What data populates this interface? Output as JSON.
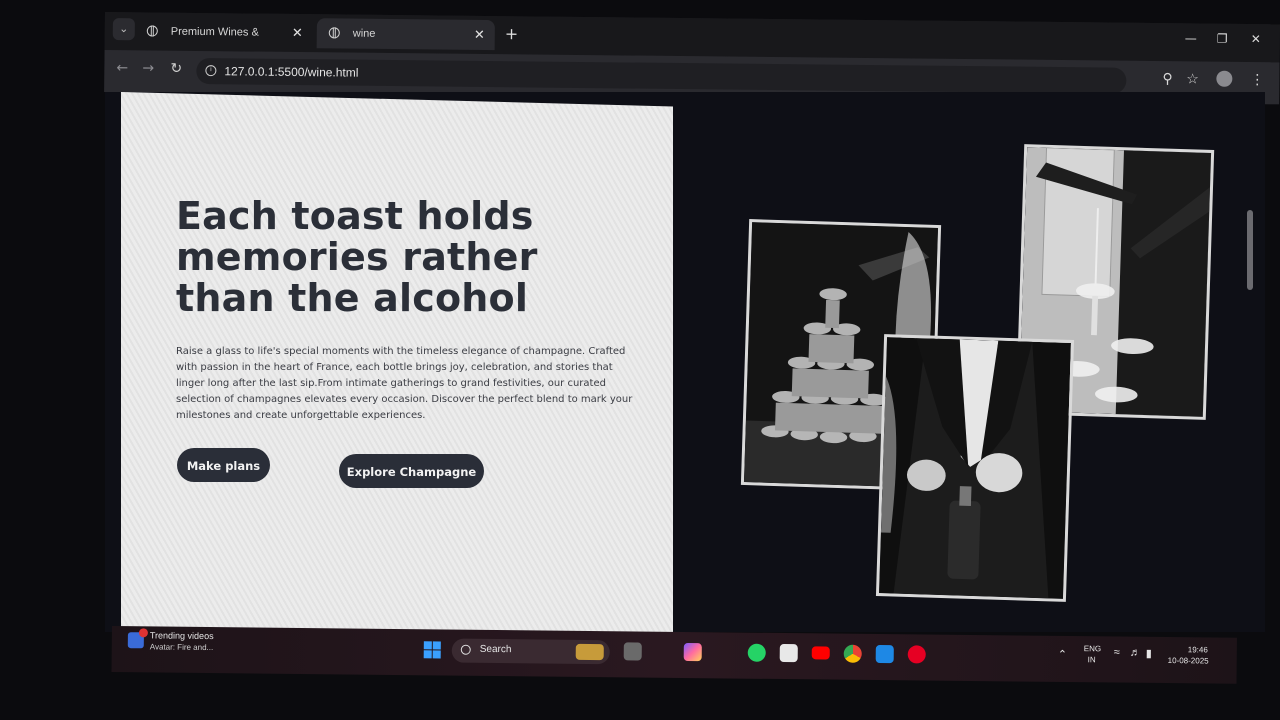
{
  "browser": {
    "tabs": [
      {
        "title": "Premium Wines & Beverages -",
        "active": false
      },
      {
        "title": "wine",
        "active": true
      }
    ],
    "url": "127.0.0.1:5500/wine.html"
  },
  "hero": {
    "headline": "Each toast holds memories rather than the alcohol",
    "paragraph": "Raise a glass to life's special moments with the timeless elegance of champagne. Crafted with passion in the heart of France, each bottle brings joy, celebration, and stories that linger long after the last sip.From intimate gatherings to grand festivities, our curated selection of champagnes elevates every occasion. Discover the perfect blend to mark your milestones and create unforgettable experiences.",
    "buttons": {
      "primary": "Make plans",
      "secondary": "Explore Champagne"
    }
  },
  "taskbar": {
    "news_title": "Trending videos",
    "news_subtitle": "Avatar: Fire and...",
    "search_label": "Search",
    "language": "ENG",
    "region": "IN",
    "time": "19:46",
    "date": "10-08-2025"
  },
  "colors": {
    "button_bg": "#2a2e38",
    "card_bg": "#e8e8e8",
    "page_bg": "#0e0f16"
  },
  "icons": [
    "tab-menu-icon",
    "globe-icon",
    "close-icon",
    "plus-icon",
    "minimize-icon",
    "restore-icon",
    "back-icon",
    "forward-icon",
    "reload-icon",
    "info-icon",
    "zoom-icon",
    "star-icon",
    "profile-icon",
    "more-icon",
    "windows-start-icon",
    "search-icon",
    "whatsapp-icon",
    "store-icon",
    "youtube-icon",
    "chrome-icon",
    "vscode-icon",
    "pinterest-icon",
    "wifi-icon",
    "volume-icon",
    "battery-icon"
  ]
}
